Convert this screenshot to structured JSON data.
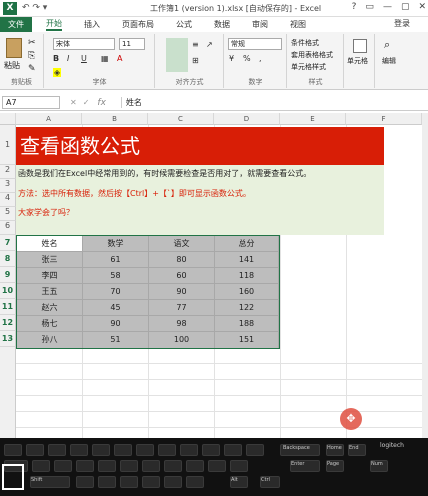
{
  "window": {
    "title": "工作簿1 (version 1).xlsx [自动保存的] - Excel",
    "qa": "↶ ↷ ▾",
    "login": "登录",
    "controls": [
      "?",
      "▭",
      "—",
      "▢",
      "✕"
    ]
  },
  "ribbon": {
    "tabs": [
      "文件",
      "开始",
      "插入",
      "页面布局",
      "公式",
      "数据",
      "审阅",
      "视图"
    ],
    "font_name": "宋体",
    "font_size": "11",
    "number_format": "常规",
    "groups": [
      "剪贴板",
      "字体",
      "对齐方式",
      "数字",
      "样式",
      "单元格",
      "编辑"
    ],
    "paste": "粘贴",
    "style_items": [
      "条件格式",
      "套用表格格式",
      "单元格样式"
    ],
    "cells": "单元格",
    "edit": "编辑",
    "font_btns": [
      "B",
      "I",
      "U",
      "A",
      "A"
    ],
    "num_btns": [
      "%",
      "‰",
      ",",
      "←.0",
      ".00→"
    ]
  },
  "formula": {
    "namebox": "A7",
    "fx": "fx",
    "value": "姓名",
    "btns": [
      "✕",
      "✓"
    ]
  },
  "columns": [
    "A",
    "B",
    "C",
    "D",
    "E",
    "F"
  ],
  "rows": [
    "1",
    "2",
    "3",
    "4",
    "5",
    "6",
    "7",
    "8",
    "9",
    "10",
    "11",
    "12",
    "13"
  ],
  "content": {
    "banner": "查看函数公式",
    "line3": "函数是我们在Excel中经常用到的，有时候需要检查是否用对了，就需要查看公式。",
    "line4": "方法：选中所有数据，然后按【Ctrl】+【`】即可显示函数公式。",
    "line5": "大家学会了吗？"
  },
  "table": {
    "headers": [
      "姓名",
      "数学",
      "语文",
      "总分"
    ],
    "rows": [
      [
        "张三",
        "61",
        "80",
        "141"
      ],
      [
        "李四",
        "58",
        "60",
        "118"
      ],
      [
        "王五",
        "70",
        "90",
        "160"
      ],
      [
        "赵六",
        "45",
        "77",
        "122"
      ],
      [
        "杨七",
        "90",
        "98",
        "188"
      ],
      [
        "孙八",
        "51",
        "100",
        "151"
      ]
    ]
  },
  "keyboard": {
    "labels": [
      "Backspace",
      "Home",
      "End",
      "Page",
      "Num",
      "Enter",
      "Shift",
      "Ctrl",
      "Alt",
      "logitech"
    ]
  }
}
